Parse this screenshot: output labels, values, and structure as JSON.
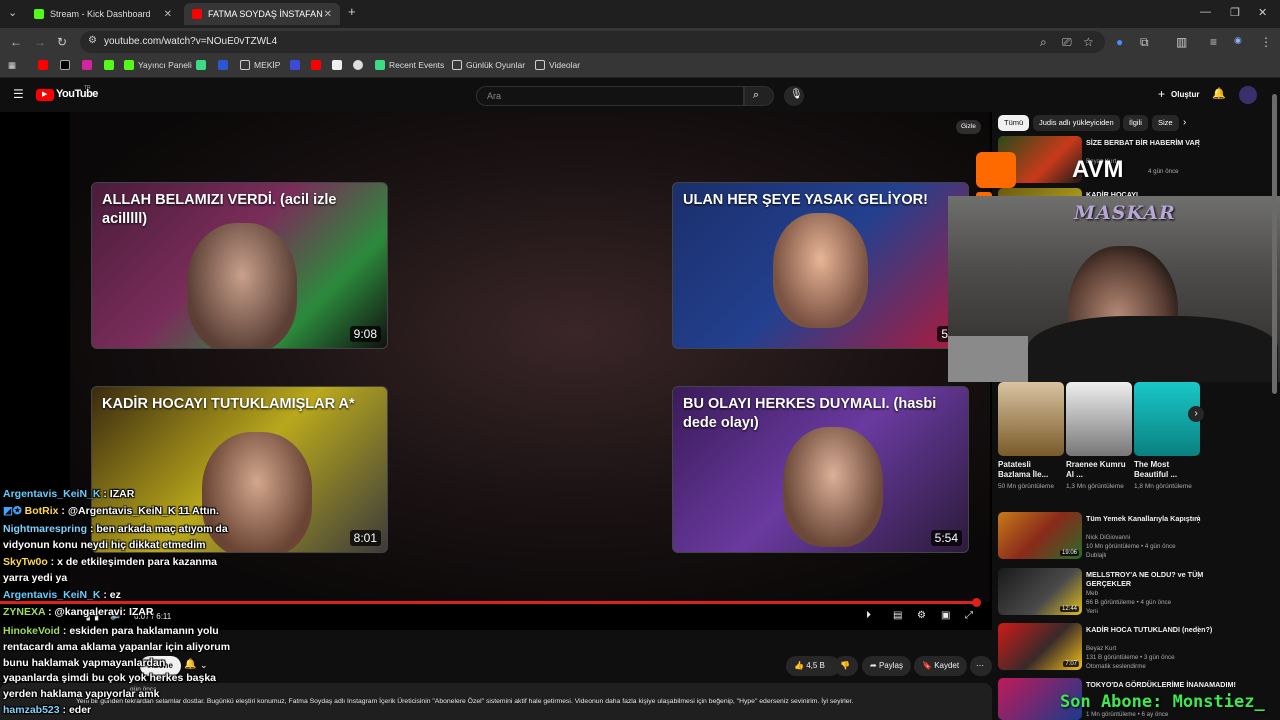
{
  "browser": {
    "tabs": [
      {
        "label": "Stream - Kick Dashboard",
        "color": "#53fc18"
      },
      {
        "label": "FATMA SOYDAŞ İNSTAFAN",
        "color": "#ff0000"
      }
    ],
    "url": "youtube.com/watch?v=NOuE0vTZWL4",
    "bookmarks": [
      "Yayıncı Paneli",
      "MEKİP",
      "Recent Events",
      "Günlük Oyunlar",
      "Videolar"
    ]
  },
  "youtube": {
    "logo": "YouTube",
    "logo_sup": "TR",
    "search_placeholder": "Ara",
    "create_label": "Oluştur"
  },
  "player": {
    "cards": [
      {
        "title": "ALLAH BELAMIZI VERDİ. (acil izle acilllll)",
        "duration": "9:08"
      },
      {
        "title": "ULAN HER ŞEYE YASAK GELİYOR!",
        "duration": "5:3"
      },
      {
        "title": "KADİR HOCAYI TUTUKLAMIŞLAR A*",
        "duration": "8:01"
      },
      {
        "title": "BU OLAYI HERKES DUYMALI. (hasbi dede olayı)",
        "duration": "5:54"
      }
    ],
    "time": "6:07 / 6:11",
    "overlay_avm": "AVM",
    "webcam_logo": "MASKAR",
    "progress": 0.99
  },
  "sidebar": {
    "hide_label": "Gizle",
    "chips": [
      "Tümü",
      "Judis adlı yükleyiciden",
      "İlgili",
      "Size"
    ],
    "videos": [
      {
        "title": "SİZE BERBAT BİR HABERİM VAR",
        "channel": "Beyaz Kurt",
        "meta": "4 gün önce"
      },
      {
        "title": "KADİR HOCAYI",
        "channel": "",
        "meta": ""
      }
    ],
    "shorts": [
      {
        "title": "Patatesli Bazlama İle...",
        "views": "50 Mn görüntüleme"
      },
      {
        "title": "Rraenee Kumru AI ...",
        "views": "1,3 Mn görüntüleme"
      },
      {
        "title": "The Most Beautiful ...",
        "views": "1,8 Mn görüntüleme"
      }
    ],
    "videos2": [
      {
        "title": "Tüm Yemek Kanallarıyla Kapıştım",
        "channel": "Nick DiGiovanni",
        "meta": "10 Mn görüntüleme • 4 gün önce",
        "badge": "Dublajlı",
        "duration": "19:06"
      },
      {
        "title": "MELLSTROY'A NE OLDU? ve TÜM GERÇEKLER",
        "channel": "Meb",
        "meta": "66 B görüntüleme • 4 gün önce",
        "badge": "Yeni",
        "duration": "12:44"
      },
      {
        "title": "KADİR HOCA TUTUKLANDI (neden?)",
        "channel": "Beyaz Kurt",
        "meta": "131 B görüntüleme • 3 gün önce",
        "badge": "Otomatik seslendirme",
        "duration": "7:07"
      },
      {
        "title": "TOKYO'DA GÖRDÜKLERİME İNANAMADIM!",
        "channel": "",
        "meta": "1 Mn görüntüleme • 6 ay önce",
        "badge": "",
        "duration": ""
      }
    ]
  },
  "below": {
    "like_count": "4,5 B",
    "share_label": "Paylaş",
    "save_label": "Kaydet",
    "subscribe_label": "Abone",
    "desc_text": "Yeni bir günden tekrardan selamlar dostlar. Bugünkü eleştiri konumuz, Fatma Soydaş adlı Instagram İçerik Üreticisinin \"Abonelere Özel\" sistemini aktif hale getirmesi. Videonun daha fazla kişiye ulaşabilmesi için beğenip, \"Hype\" ederseniz sevinirim. İyi seyirler.",
    "desc_when": "gün önce"
  },
  "chat": [
    {
      "user": "Argentavis_KeiN_K",
      "msg": ": IZAR"
    },
    {
      "user": "BotRix",
      "msg": ": @Argentavis_KeiN_K 11 Attın."
    },
    {
      "user": "Nightmarespring",
      "msg": ": ben arkada maç atıyom da"
    },
    {
      "user": "",
      "msg": "vidyonun konu neydi hiç dikkat etmedim"
    },
    {
      "user": "SkyTw0o",
      "msg": ": x de etkileşimden para kazanma"
    },
    {
      "user": "",
      "msg": "yarra yedi ya"
    },
    {
      "user": "Argentavis_KeiN_K",
      "msg": ": ez"
    },
    {
      "user": "ZYNEXA",
      "msg": ": @kangaleravi: IZAR"
    },
    {
      "user": "HinokeVoid",
      "msg": ": eskiden para haklamanın yolu"
    },
    {
      "user": "",
      "msg": "rentacardı ama aklama yapanlar için aliyorum"
    },
    {
      "user": "",
      "msg": "bunu haklamak yapmayanlardan"
    },
    {
      "user": "",
      "msg": "yapanlarda şimdi bu çok yok herkes başka"
    },
    {
      "user": "",
      "msg": "yerden haklama yapıyorlar amk"
    },
    {
      "user": "hamzab523",
      "msg": ": eder"
    }
  ],
  "ticker": "Son Abone: Monstiez_"
}
